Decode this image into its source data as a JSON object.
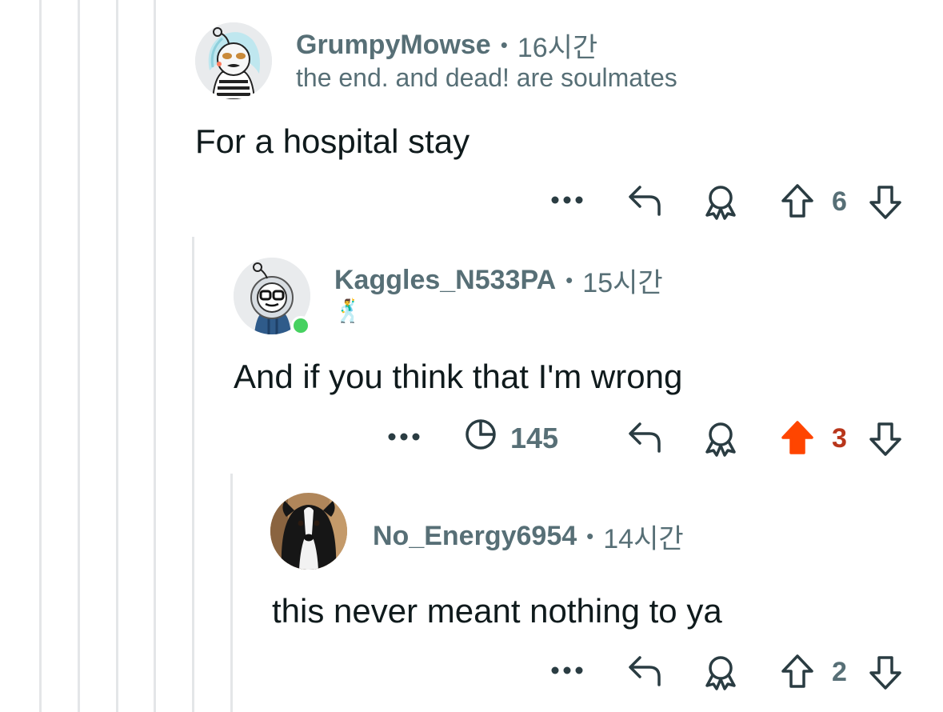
{
  "comments": [
    {
      "username": "GrumpyMowse",
      "time": "16시간",
      "flair": "the end. and dead! are soulmates",
      "body": "For a hospital stay",
      "score": "6",
      "vote": "none"
    },
    {
      "username": "Kaggles_N533PA",
      "time": "15시간",
      "flair": "🕺",
      "body": "And if you think that I'm wrong",
      "views": "145",
      "score": "3",
      "vote": "up",
      "online": true
    },
    {
      "username": "No_Energy6954",
      "time": "14시간",
      "body": "this never meant nothing to ya",
      "score": "2",
      "vote": "none"
    }
  ],
  "separator": "•",
  "icons": {
    "more": "more-dots-icon",
    "reply": "reply-arrow-icon",
    "award": "award-icon",
    "upvote": "upvote-arrow-icon",
    "downvote": "downvote-arrow-icon",
    "views": "pie-chart-icon"
  },
  "colors": {
    "meta": "#576f76",
    "text": "#0f1a1c",
    "upvote_active": "#ff4500",
    "upvote_count_active": "#b8361b",
    "thread_line": "#e4e6e8",
    "online": "#46d160"
  }
}
